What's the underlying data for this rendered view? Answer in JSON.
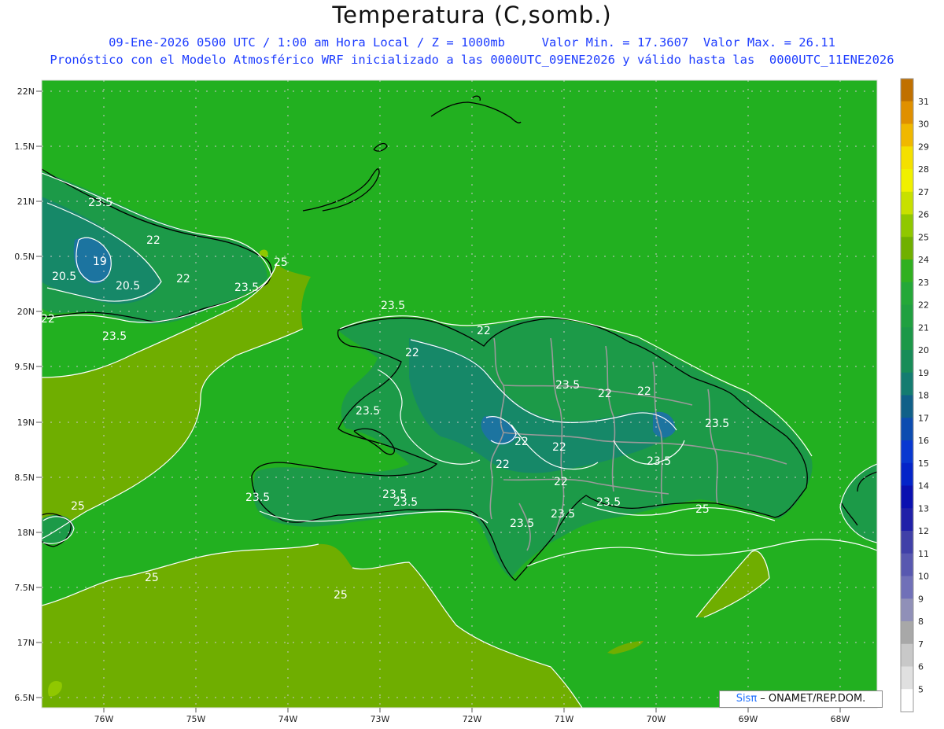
{
  "title": "Temperatura (C,somb.)",
  "subtitle_line1": "09-Ene-2026 0500 UTC / 1:00 am Hora Local / Z = 1000mb     Valor Min. = 17.3607  Valor Max. = 26.11",
  "subtitle_line2": "Pronóstico con el Modelo Atmosférico WRF inicializado a las 0000UTC_09ENE2026 y válido hasta las  0000UTC_11ENE2026",
  "credit": {
    "brand": "Sisπ",
    "text": " – ONAMET/REP.DOM."
  },
  "lat_labels": [
    "22N",
    "1.5N",
    "21N",
    "0.5N",
    "20N",
    "9.5N",
    "19N",
    "8.5N",
    "18N",
    "7.5N",
    "17N",
    "6.5N"
  ],
  "lon_labels": [
    "76W",
    "75W",
    "74W",
    "73W",
    "72W",
    "71W",
    "70W",
    "69W",
    "68W"
  ],
  "colorbar": {
    "levels": [
      "31",
      "30",
      "29",
      "28",
      "27",
      "26",
      "25",
      "24",
      "23",
      "22",
      "21",
      "20",
      "19",
      "18",
      "17",
      "16",
      "15",
      "14",
      "13",
      "12",
      "11",
      "10",
      "9",
      "8",
      "7",
      "6",
      "5"
    ],
    "colors": [
      "#c07000",
      "#e09000",
      "#f0b800",
      "#f4e000",
      "#f0f000",
      "#c8e000",
      "#90c800",
      "#70b000",
      "#30b020",
      "#24a838",
      "#20a040",
      "#1c9848",
      "#188c58",
      "#147c70",
      "#106088",
      "#0c4cb0",
      "#0838d0",
      "#0424c8",
      "#0a10b0",
      "#2020a8",
      "#4040a8",
      "#5858b0",
      "#7070b8",
      "#9090b8",
      "#a8a8a8",
      "#c8c8c8",
      "#e0e0e0",
      "#ffffff"
    ]
  },
  "contour_labels": [
    {
      "text": "23.5"
    },
    {
      "text": "22"
    },
    {
      "text": "19"
    },
    {
      "text": "20.5"
    },
    {
      "text": "20.5"
    },
    {
      "text": "22"
    },
    {
      "text": "23.5"
    },
    {
      "text": "25"
    },
    {
      "text": "22"
    },
    {
      "text": "23.5"
    },
    {
      "text": "23.5"
    },
    {
      "text": "22"
    },
    {
      "text": "22"
    },
    {
      "text": "23.5"
    },
    {
      "text": "23.5"
    },
    {
      "text": "22"
    },
    {
      "text": "22"
    },
    {
      "text": "22"
    },
    {
      "text": "23.5"
    },
    {
      "text": "22"
    },
    {
      "text": "22"
    },
    {
      "text": "22"
    },
    {
      "text": "23.5"
    },
    {
      "text": "23.5"
    },
    {
      "text": "23.5"
    },
    {
      "text": "23.5"
    },
    {
      "text": "23.5"
    },
    {
      "text": "23.5"
    },
    {
      "text": "23.5"
    },
    {
      "text": "25"
    },
    {
      "text": "25"
    },
    {
      "text": "25"
    },
    {
      "text": "25"
    }
  ]
}
